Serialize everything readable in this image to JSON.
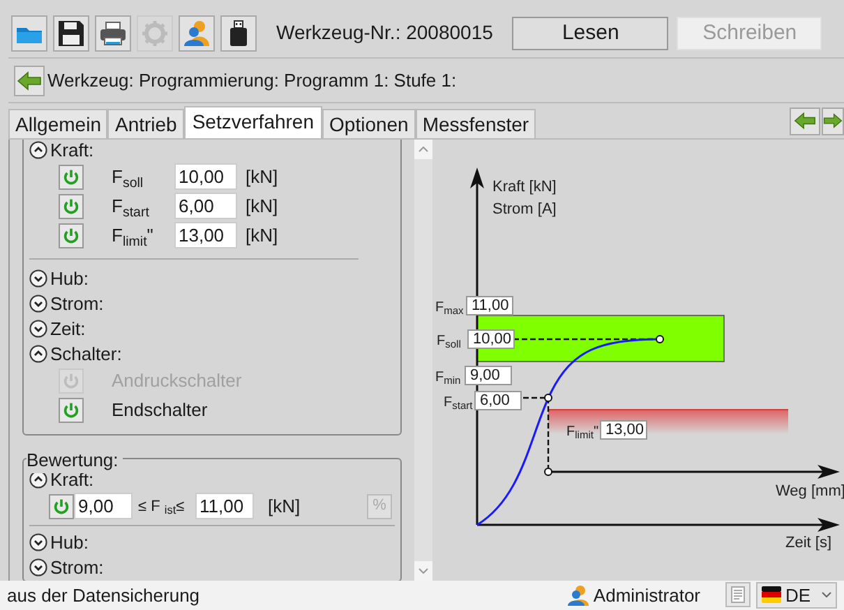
{
  "toolbar": [
    {
      "kind": "folder",
      "disabled": false
    },
    {
      "kind": "floppy",
      "disabled": false
    },
    {
      "kind": "printer",
      "disabled": false
    },
    {
      "kind": "gear",
      "disabled": true
    },
    {
      "kind": "users",
      "disabled": false
    },
    {
      "kind": "usb",
      "disabled": false
    }
  ],
  "tool_number": "Werkzeug-Nr.: 20080015",
  "buttons": [
    {
      "label": "Lesen",
      "disabled": false
    },
    {
      "label": "Schreiben",
      "disabled": true
    }
  ],
  "breadcrumb": "Werkzeug: Programmierung: Programm 1: Stufe 1:",
  "tabs": [
    {
      "label": "Allgemein",
      "selected": false
    },
    {
      "label": "Antrieb",
      "selected": false
    },
    {
      "label": "Setzverfahren",
      "selected": true
    },
    {
      "label": "Optionen",
      "selected": false
    },
    {
      "label": "Messfenster",
      "selected": false
    }
  ],
  "setup": [
    {
      "label": "Kraft:",
      "expanded": true,
      "rows": [
        {
          "label": "F$_{soll}$",
          "value": "10,00",
          "unit": "[kN]",
          "on": true
        },
        {
          "label": "F$_{start}$",
          "value": "6,00",
          "unit": "[kN]",
          "on": true
        },
        {
          "label": "F$_{limit}$\"",
          "value": "13,00",
          "unit": "[kN]",
          "on": true
        }
      ]
    },
    {
      "label": "Hub:",
      "expanded": false
    },
    {
      "label": "Strom:",
      "expanded": false
    },
    {
      "label": "Zeit:",
      "expanded": false
    },
    {
      "label": "Schalter:",
      "expanded": true,
      "switches": [
        {
          "label": "Andruckschalter",
          "disabled": true
        },
        {
          "label": "Endschalter",
          "disabled": false
        }
      ]
    }
  ],
  "evaluation": {
    "title": "Bewertung:",
    "sections": [
      {
        "label": "Kraft:",
        "expanded": true,
        "row": {
          "on": true,
          "min": "9,00",
          "relation": "≤ F $_{ist}$≤",
          "max": "11,00",
          "unit": "[kN]",
          "percent": "%"
        }
      },
      {
        "label": "Hub:",
        "expanded": false
      },
      {
        "label": "Strom:",
        "expanded": false
      }
    ]
  },
  "diagram": {
    "y_axis_labels": [
      "Kraft [kN]",
      "Strom [A]"
    ],
    "x_axis_labels": [
      "Weg [mm]",
      "Zeit [s]"
    ],
    "fields": [
      {
        "label": "F$_{max}$",
        "value": "11,00"
      },
      {
        "label": "F$_{soll}$",
        "value": "10,00"
      },
      {
        "label": "F$_{min}$",
        "value": "9,00"
      },
      {
        "label": "F$_{start}$",
        "value": "6,00"
      },
      {
        "label": "F$_{limit}$\"",
        "value": "13,00"
      }
    ]
  },
  "status_bar": {
    "message": "aus der Datensicherung",
    "user": "Administrator",
    "language": "DE"
  }
}
